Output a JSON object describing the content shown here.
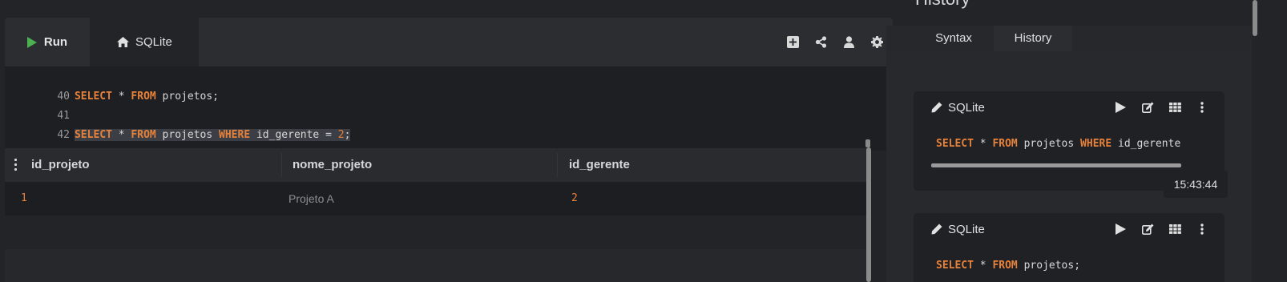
{
  "toolbar": {
    "run_label": "Run",
    "db_label": "SQLite",
    "icons": [
      "add-icon",
      "share-icon",
      "user-icon",
      "gear-icon"
    ]
  },
  "editor": {
    "lines": [
      {
        "no": "40",
        "tokens": [
          {
            "t": "kw",
            "v": "SELECT"
          },
          {
            "t": "txt",
            "v": " * "
          },
          {
            "t": "kw",
            "v": "FROM"
          },
          {
            "t": "txt",
            "v": " projetos;"
          }
        ]
      },
      {
        "no": "41",
        "tokens": []
      },
      {
        "no": "42",
        "tokens": [
          {
            "t": "kw",
            "v": "SELECT"
          },
          {
            "t": "txt",
            "v": " * "
          },
          {
            "t": "kw",
            "v": "FROM"
          },
          {
            "t": "txt",
            "v": " projetos "
          },
          {
            "t": "kw",
            "v": "WHERE"
          },
          {
            "t": "txt",
            "v": " id_gerente = "
          },
          {
            "t": "num",
            "v": "2"
          },
          {
            "t": "txt",
            "v": ";"
          }
        ]
      }
    ]
  },
  "results": {
    "columns": [
      "id_projeto",
      "nome_projeto",
      "id_gerente"
    ],
    "rows": [
      [
        "1",
        "Projeto A",
        "2"
      ]
    ]
  },
  "history_panel": {
    "title": "History",
    "tabs": [
      {
        "label": "Syntax",
        "active": false
      },
      {
        "label": "History",
        "active": true
      }
    ],
    "entries": [
      {
        "db": "SQLite",
        "query": [
          {
            "t": "kw",
            "v": "SELECT"
          },
          {
            "t": "txt",
            "v": " * "
          },
          {
            "t": "kw",
            "v": "FROM"
          },
          {
            "t": "txt",
            "v": " projetos "
          },
          {
            "t": "kw",
            "v": "WHERE"
          },
          {
            "t": "txt",
            "v": " id_gerente"
          }
        ],
        "time": "15:43:44"
      },
      {
        "db": "SQLite",
        "query": [
          {
            "t": "kw",
            "v": "SELECT"
          },
          {
            "t": "txt",
            "v": " * "
          },
          {
            "t": "kw",
            "v": "FROM"
          },
          {
            "t": "txt",
            "v": " projetos;"
          }
        ],
        "time": ""
      }
    ]
  },
  "colors": {
    "keyword": "#e8823a",
    "run_play": "#4caf50",
    "background": "#222428"
  }
}
